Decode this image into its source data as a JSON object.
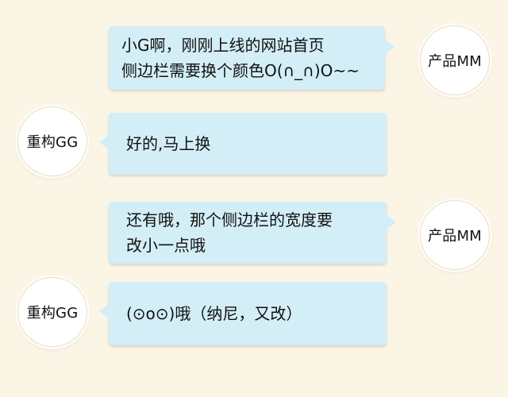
{
  "colors": {
    "background": "#fbf5e6",
    "bubble": "#d3eef7",
    "text": "#111111"
  },
  "messages": [
    {
      "speaker": "产品MM",
      "side": "right",
      "lines": [
        "小G啊，刚刚上线的网站首页",
        "侧边栏需要换个颜色O(∩_∩)O~~"
      ]
    },
    {
      "speaker": "重构GG",
      "side": "left",
      "lines": [
        "好的,马上换"
      ]
    },
    {
      "speaker": "产品MM",
      "side": "right",
      "lines": [
        "还有哦，那个侧边栏的宽度要",
        "改小一点哦"
      ]
    },
    {
      "speaker": "重构GG",
      "side": "left",
      "lines": [
        "(⊙o⊙)哦（纳尼，又改）"
      ]
    }
  ]
}
